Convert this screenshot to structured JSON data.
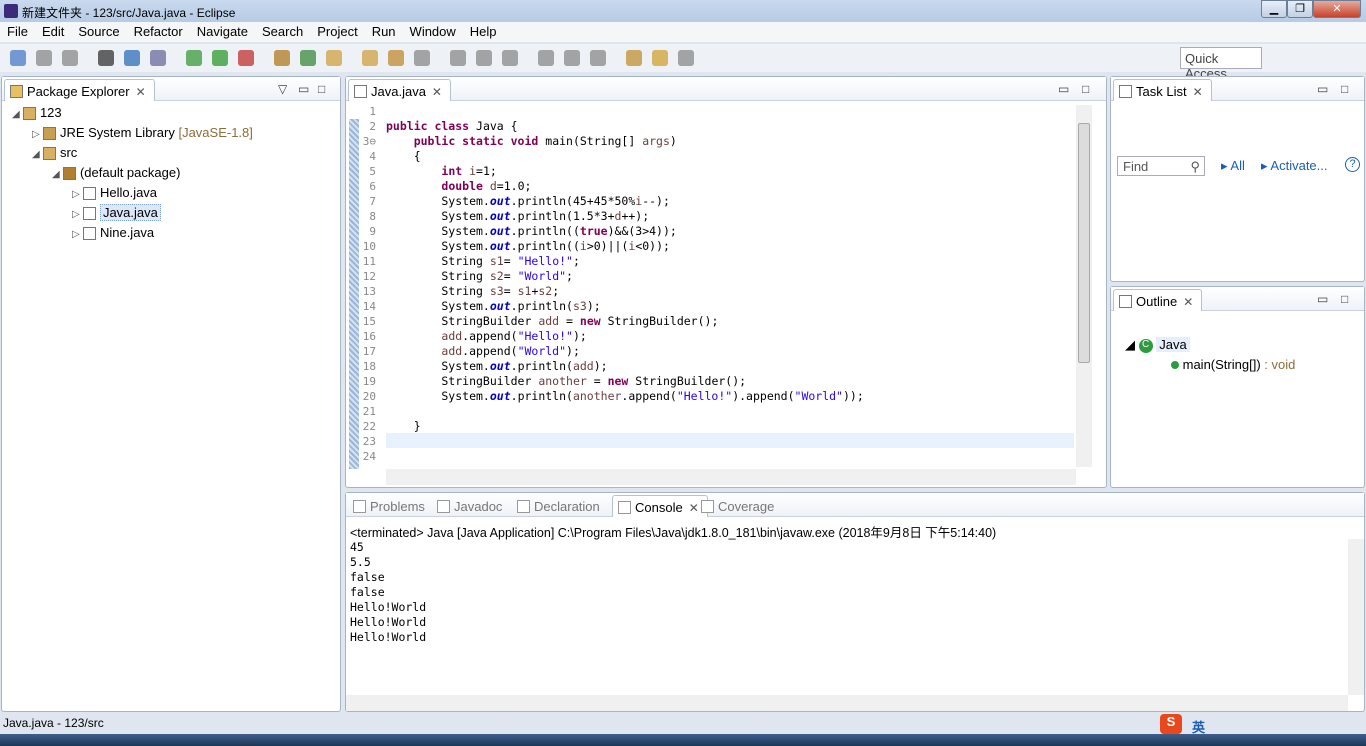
{
  "window": {
    "title": "新建文件夹 - 123/src/Java.java - Eclipse",
    "minimize": "▁",
    "maximize": "❐",
    "close": "✕"
  },
  "menu": [
    "File",
    "Edit",
    "Source",
    "Refactor",
    "Navigate",
    "Search",
    "Project",
    "Run",
    "Window",
    "Help"
  ],
  "quick_access": {
    "placeholder": "Quick Access"
  },
  "package_explorer": {
    "title": "Package Explorer",
    "items": [
      {
        "label": "123",
        "depth": 0,
        "icon": "project-icon"
      },
      {
        "label": "JRE System Library",
        "extra": "[JavaSE-1.8]",
        "depth": 1,
        "icon": "library-icon"
      },
      {
        "label": "src",
        "depth": 1,
        "icon": "folder-icon"
      },
      {
        "label": "(default package)",
        "depth": 2,
        "icon": "package-icon"
      },
      {
        "label": "Hello.java",
        "depth": 3,
        "icon": "java-file-icon"
      },
      {
        "label": "Java.java",
        "depth": 3,
        "icon": "java-file-icon",
        "selected": true
      },
      {
        "label": "Nine.java",
        "depth": 3,
        "icon": "java-file-icon"
      }
    ]
  },
  "editor": {
    "tab": "Java.java",
    "lines": [
      [],
      [
        [
          "kw",
          "public class "
        ],
        [
          "",
          "Java {"
        ]
      ],
      [
        [
          "",
          "    "
        ],
        [
          "kw",
          "public static void "
        ],
        [
          "",
          "main(String[] "
        ],
        [
          "var",
          "args"
        ],
        [
          "",
          ")"
        ]
      ],
      [
        [
          "",
          "    {"
        ]
      ],
      [
        [
          "",
          "        "
        ],
        [
          "kw",
          "int "
        ],
        [
          "var",
          "i"
        ],
        [
          "",
          "=1;"
        ]
      ],
      [
        [
          "",
          "        "
        ],
        [
          "kw",
          "double "
        ],
        [
          "var",
          "d"
        ],
        [
          "",
          "=1.0;"
        ]
      ],
      [
        [
          "",
          "        System."
        ],
        [
          "fld",
          "out"
        ],
        [
          "",
          ".println(45+45*50%"
        ],
        [
          "var",
          "i"
        ],
        [
          "",
          "--);"
        ]
      ],
      [
        [
          "",
          "        System."
        ],
        [
          "fld",
          "out"
        ],
        [
          "",
          ".println(1.5*3+"
        ],
        [
          "var",
          "d"
        ],
        [
          "",
          "++);"
        ]
      ],
      [
        [
          "",
          "        System."
        ],
        [
          "fld",
          "out"
        ],
        [
          "",
          ".println(("
        ],
        [
          "kw",
          "true"
        ],
        [
          "",
          ")&&(3>4));"
        ]
      ],
      [
        [
          "",
          "        System."
        ],
        [
          "fld",
          "out"
        ],
        [
          "",
          ".println(("
        ],
        [
          "var",
          "i"
        ],
        [
          "",
          ">0)||("
        ],
        [
          "var",
          "i"
        ],
        [
          "",
          "<0));"
        ]
      ],
      [
        [
          "",
          "        String "
        ],
        [
          "var",
          "s1"
        ],
        [
          "",
          "= "
        ],
        [
          "str",
          "\"Hello!\""
        ],
        [
          "",
          ";"
        ]
      ],
      [
        [
          "",
          "        String "
        ],
        [
          "var",
          "s2"
        ],
        [
          "",
          "= "
        ],
        [
          "str",
          "\"World\""
        ],
        [
          "",
          ";"
        ]
      ],
      [
        [
          "",
          "        String "
        ],
        [
          "var",
          "s3"
        ],
        [
          "",
          "= "
        ],
        [
          "var",
          "s1"
        ],
        [
          "",
          "+"
        ],
        [
          "var",
          "s2"
        ],
        [
          "",
          ";"
        ]
      ],
      [
        [
          "",
          "        System."
        ],
        [
          "fld",
          "out"
        ],
        [
          "",
          ".println("
        ],
        [
          "var",
          "s3"
        ],
        [
          "",
          ");"
        ]
      ],
      [
        [
          "",
          "        StringBuilder "
        ],
        [
          "var",
          "add"
        ],
        [
          "",
          " = "
        ],
        [
          "kw",
          "new "
        ],
        [
          "",
          "StringBuilder();"
        ]
      ],
      [
        [
          "",
          "        "
        ],
        [
          "var",
          "add"
        ],
        [
          "",
          ".append("
        ],
        [
          "str",
          "\"Hello!\""
        ],
        [
          "",
          ");"
        ]
      ],
      [
        [
          "",
          "        "
        ],
        [
          "var",
          "add"
        ],
        [
          "",
          ".append("
        ],
        [
          "str",
          "\"World\""
        ],
        [
          "",
          ");"
        ]
      ],
      [
        [
          "",
          "        System."
        ],
        [
          "fld",
          "out"
        ],
        [
          "",
          ".println("
        ],
        [
          "var",
          "add"
        ],
        [
          "",
          ");"
        ]
      ],
      [
        [
          "",
          "        StringBuilder "
        ],
        [
          "var",
          "another"
        ],
        [
          "",
          " = "
        ],
        [
          "kw",
          "new "
        ],
        [
          "",
          "StringBuilder();"
        ]
      ],
      [
        [
          "",
          "        System."
        ],
        [
          "fld",
          "out"
        ],
        [
          "",
          ".println("
        ],
        [
          "var",
          "another"
        ],
        [
          "",
          ".append("
        ],
        [
          "str",
          "\"Hello!\""
        ],
        [
          "",
          ").append("
        ],
        [
          "str",
          "\"World\""
        ],
        [
          "",
          "));"
        ]
      ],
      [],
      [
        [
          "",
          "    }"
        ]
      ],
      [],
      []
    ]
  },
  "task_list": {
    "title": "Task List",
    "find_placeholder": "Find",
    "all": "All",
    "activate": "Activate..."
  },
  "outline": {
    "title": "Outline",
    "class": "Java",
    "method": "main(String[])",
    "method_type": " : void"
  },
  "bottom_tabs": [
    "Problems",
    "Javadoc",
    "Declaration",
    "Console",
    "Coverage"
  ],
  "console": {
    "header": "<terminated> Java [Java Application] C:\\Program Files\\Java\\jdk1.8.0_181\\bin\\javaw.exe (2018年9月8日 下午5:14:40)",
    "output": [
      "45",
      "5.5",
      "false",
      "false",
      "Hello!World",
      "Hello!World",
      "Hello!World"
    ]
  },
  "status_bar": {
    "text": "Java.java - 123/src"
  },
  "ime": {
    "label": "英"
  }
}
